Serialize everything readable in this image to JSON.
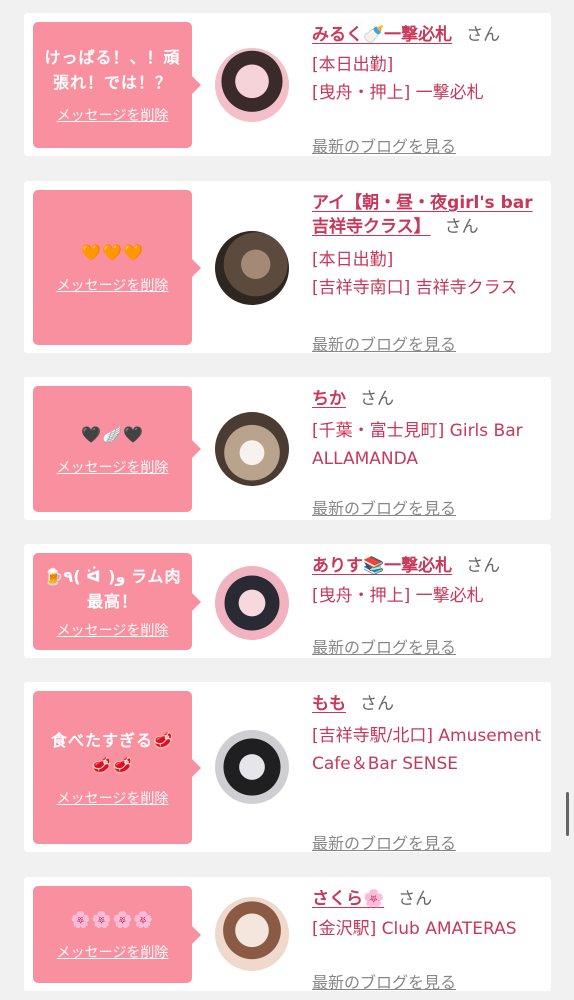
{
  "cards": [
    {
      "message": "けっぱる！、！頑張れ！では！？",
      "delete_label": "メッセージを削除",
      "name": "みるく🍼一撃必札",
      "suffix": "さん",
      "lines": [
        "[本日出勤]",
        "[曳舟・押上] 一撃必札"
      ],
      "blog": "最新のブログを見る",
      "avatar_colors": [
        "#f3c0c9",
        "#3b2a2a"
      ]
    },
    {
      "message": "🧡🧡🧡",
      "delete_label": "メッセージを削除",
      "name": "アイ【朝・昼・夜girl's bar吉祥寺クラス】",
      "suffix": "さん",
      "lines": [
        "[本日出勤]",
        "[吉祥寺南口] 吉祥寺クラス"
      ],
      "blog": "最新のブログを見る",
      "avatar_colors": [
        "#6b5747",
        "#2e2620"
      ]
    },
    {
      "message": "🖤🪽🖤",
      "delete_label": "メッセージを削除",
      "name": "ちか",
      "suffix": "さん",
      "lines": [
        "[千葉・富士見町] Girls Bar ALLAMANDA"
      ],
      "blog": "最新のブログを見る",
      "avatar_colors": [
        "#b9a38d",
        "#4a3c33"
      ]
    },
    {
      "message": "🍺٩( ᐛ )و ラム肉最高！",
      "delete_label": "メッセージを削除",
      "name": "ありす📚一撃必札",
      "suffix": "さん",
      "lines": [
        "[曳舟・押上] 一撃必札"
      ],
      "blog": "最新のブログを見る",
      "avatar_colors": [
        "#f2b3c0",
        "#2a2a35"
      ]
    },
    {
      "message": "食べたすぎる🥩🥩🥩",
      "delete_label": "メッセージを削除",
      "name": "もも",
      "suffix": "さん",
      "lines": [
        "[吉祥寺駅/北口] Amusement Cafe＆Bar SENSE"
      ],
      "blog": "最新のブログを見る",
      "avatar_colors": [
        "#cfcfd3",
        "#1f1f22"
      ]
    },
    {
      "message": "🌸🌸🌸🌸",
      "delete_label": "メッセージを削除",
      "name": "さくら🌸",
      "suffix": "さん",
      "lines": [
        "[金沢駅] Club AMATERAS"
      ],
      "blog": "最新のブログを見る",
      "avatar_colors": [
        "#f4e6dc",
        "#8a5a44"
      ]
    }
  ]
}
